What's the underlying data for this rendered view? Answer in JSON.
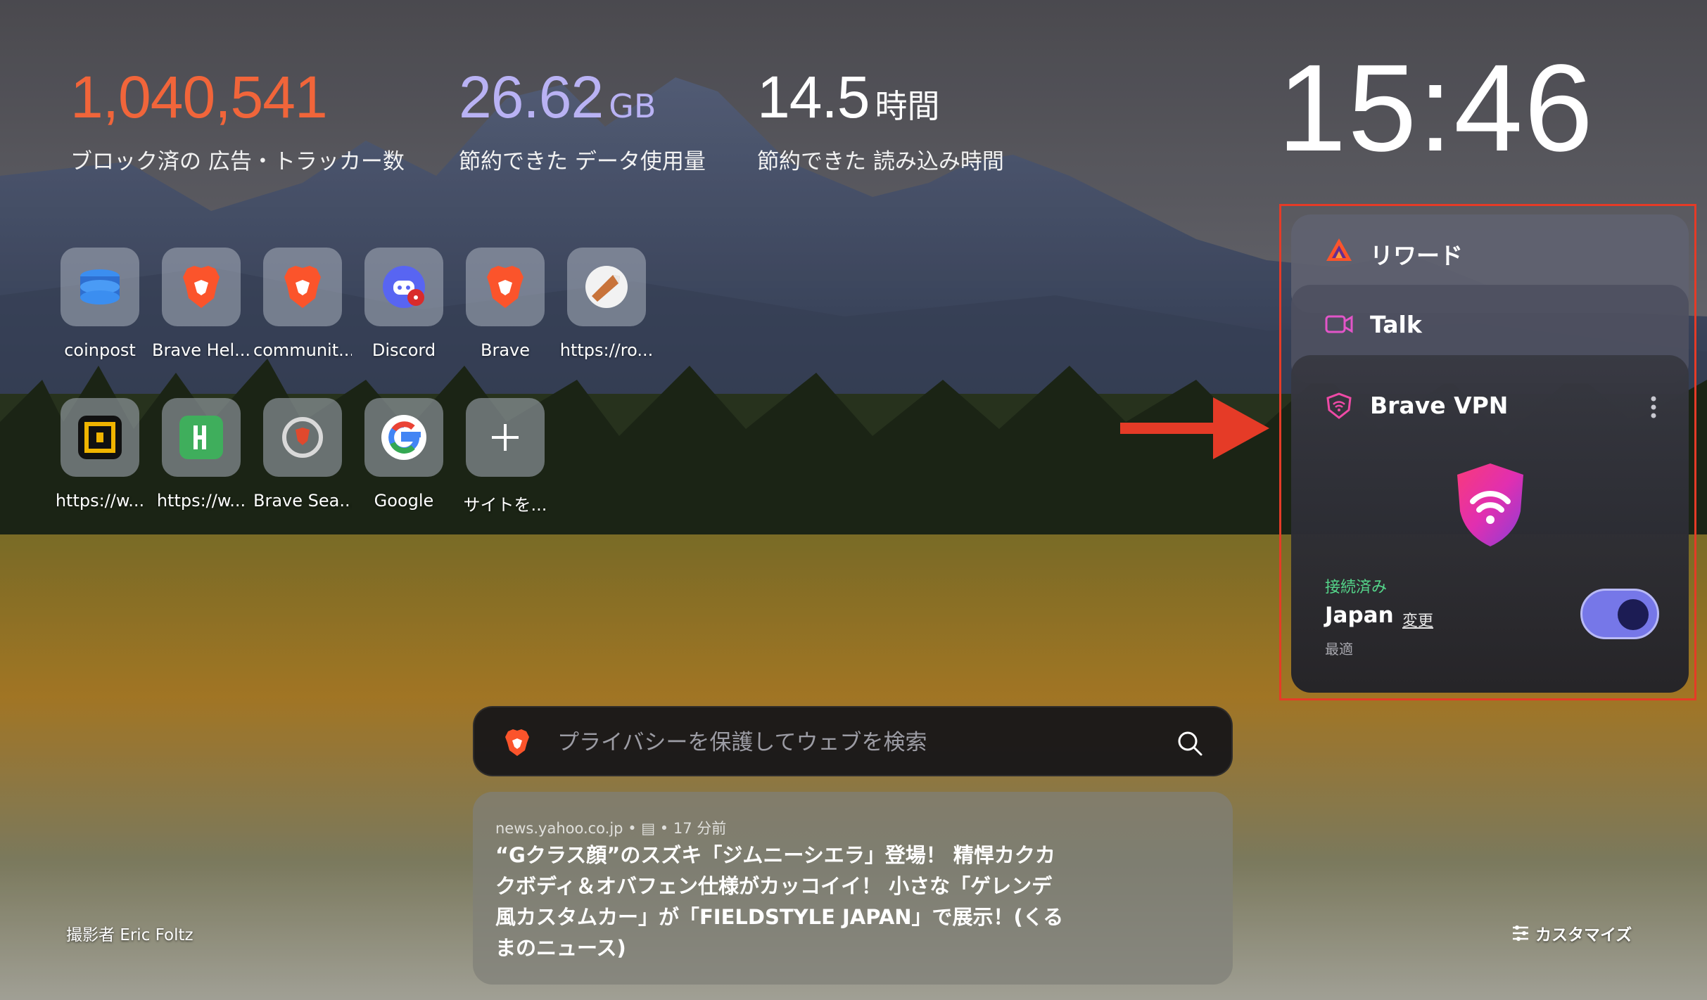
{
  "stats": {
    "ads_blocked_value": "1,040,541",
    "ads_blocked_label": "ブロック済の 広告・トラッカー数",
    "data_saved_value": "26.62",
    "data_saved_unit": "GB",
    "data_saved_label": "節約できた データ使用量",
    "time_saved_value": "14.5",
    "time_saved_unit": "時間",
    "time_saved_label": "節約できた 読み込み時間"
  },
  "clock": "15:46",
  "top_sites": [
    {
      "label": "coinpost",
      "icon": "coinpost-icon"
    },
    {
      "label": "Brave Hel...",
      "icon": "brave-lion-icon"
    },
    {
      "label": "communit...",
      "icon": "brave-lion-icon"
    },
    {
      "label": "Discord",
      "icon": "discord-icon"
    },
    {
      "label": "Brave",
      "icon": "brave-lion-icon"
    },
    {
      "label": "https://ro...",
      "icon": "rocket-icon"
    },
    {
      "label": "https://w...",
      "icon": "grid-app-icon"
    },
    {
      "label": "https://w...",
      "icon": "green-app-icon"
    },
    {
      "label": "Brave Sea...",
      "icon": "brave-search-icon"
    },
    {
      "label": "Google",
      "icon": "google-icon"
    },
    {
      "label": "サイトを...",
      "icon": "plus-icon"
    }
  ],
  "widgets": {
    "rewards_title": "リワード",
    "talk_title": "Talk",
    "vpn": {
      "title": "Brave VPN",
      "status": "接続済み",
      "country": "Japan",
      "change_link": "変更",
      "region_note": "最適",
      "toggle_on": true
    }
  },
  "search": {
    "placeholder": "プライバシーを保護してウェブを検索"
  },
  "news": {
    "source": "news.yahoo.co.jp",
    "age": "17 分前",
    "headline": "“Gクラス顔”のスズキ「ジムニーシエラ」登場！ 精悍カクカクボディ＆オバフェン仕様がカッコイイ！ 小さな「ゲレンデ風カスタムカー」が「FIELDSTYLE JAPAN」で展示！(くるまのニュース)"
  },
  "footer": {
    "photo_credit": "撮影者 Eric Foltz",
    "customize_label": "カスタマイズ"
  },
  "colors": {
    "ads_accent": "#f1653a",
    "data_accent": "#b9b2f4",
    "vpn_connected": "#54d68a",
    "toggle_on": "#7677e8",
    "annotation_red": "#e53b27"
  }
}
